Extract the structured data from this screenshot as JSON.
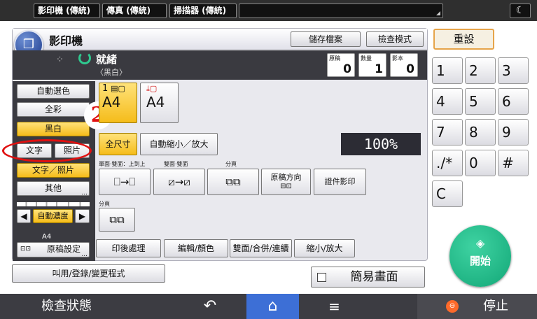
{
  "top_tabs": [
    "影印機 (傳統)",
    "傳真 (傳統)",
    "掃描器 (傳統)"
  ],
  "app_title": "影印機",
  "header_buttons": {
    "store": "儲存檔案",
    "check": "檢查模式"
  },
  "status": {
    "ready": "就緒",
    "sub": "〈黑白〉"
  },
  "counters": [
    {
      "label": "原稿",
      "value": "0"
    },
    {
      "label": "數量",
      "value": "1"
    },
    {
      "label": "影本",
      "value": "0"
    }
  ],
  "color_buttons": {
    "auto": "自動選色",
    "full": "全彩",
    "bw": "黑白"
  },
  "mode_buttons": {
    "text": "文字",
    "photo": "照片",
    "text_photo": "文字／照片",
    "other": "其他"
  },
  "density": {
    "label": "自動濃度",
    "left": "◀",
    "right": "▶"
  },
  "original": {
    "size": "A4",
    "label": "原稿設定"
  },
  "badge": "2",
  "paper": {
    "tray1": "1",
    "size1": "A4",
    "size2": "A4"
  },
  "scale_buttons": {
    "full": "全尺寸",
    "auto": "自動縮小／放大"
  },
  "zoom": "100%",
  "duplex_labels": {
    "single_double": "單面‧雙面：上到上",
    "double_double": "雙面‧雙面",
    "combine": "分頁",
    "sort": "分頁"
  },
  "function_buttons": {
    "orientation": "原稿方向",
    "id_copy": "證件影印"
  },
  "tabs": [
    "印後處理",
    "編輯/顏色",
    "雙面/合併/連續",
    "縮小/放大"
  ],
  "program": "叫用/登錄/變更程式",
  "simple_screen": "簡易畫面",
  "reset": "重設",
  "keypad": [
    "1",
    "2",
    "3",
    "4",
    "5",
    "6",
    "7",
    "8",
    "9",
    "./*",
    "0",
    "#",
    "C"
  ],
  "start": "開始",
  "nav": {
    "check_status": "檢查狀態",
    "stop": "停止"
  },
  "colors": {
    "accent": "#f5bc1a",
    "start": "#12a777",
    "highlight": "#e01010",
    "nav_active": "#3d6fd6"
  }
}
